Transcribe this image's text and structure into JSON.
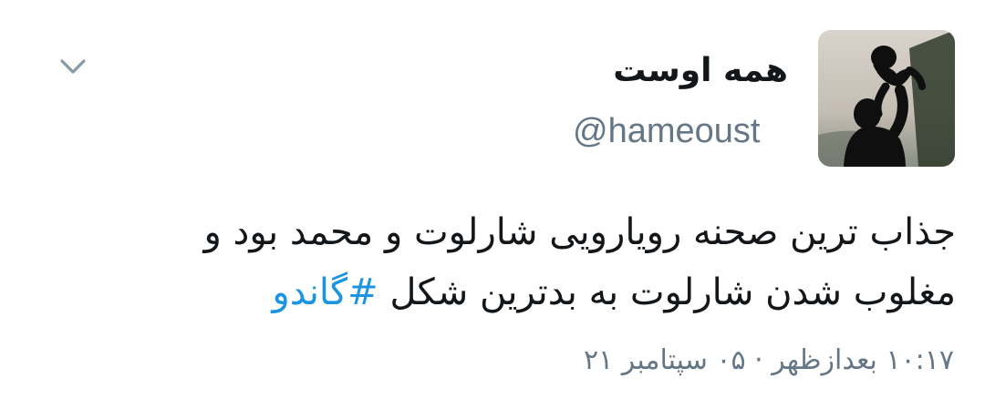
{
  "tweet": {
    "display_name": "همه اوست",
    "handle": "@hameoust",
    "text_line_1": "جذاب ترین صحنه رویارویی شارلوت و محمد بود و",
    "text_line_2_prefix": "مغلوب شدن شارلوت به بدترین شکل ",
    "hashtag": "#گاندو",
    "timestamp": "۱۰:۱۷ بعدازظهر · ۰۵ سپتامبر ۲۱",
    "caret_icon": "chevron-down-icon",
    "colors": {
      "text": "#14171a",
      "secondary": "#657786",
      "link": "#1b95e0"
    }
  }
}
